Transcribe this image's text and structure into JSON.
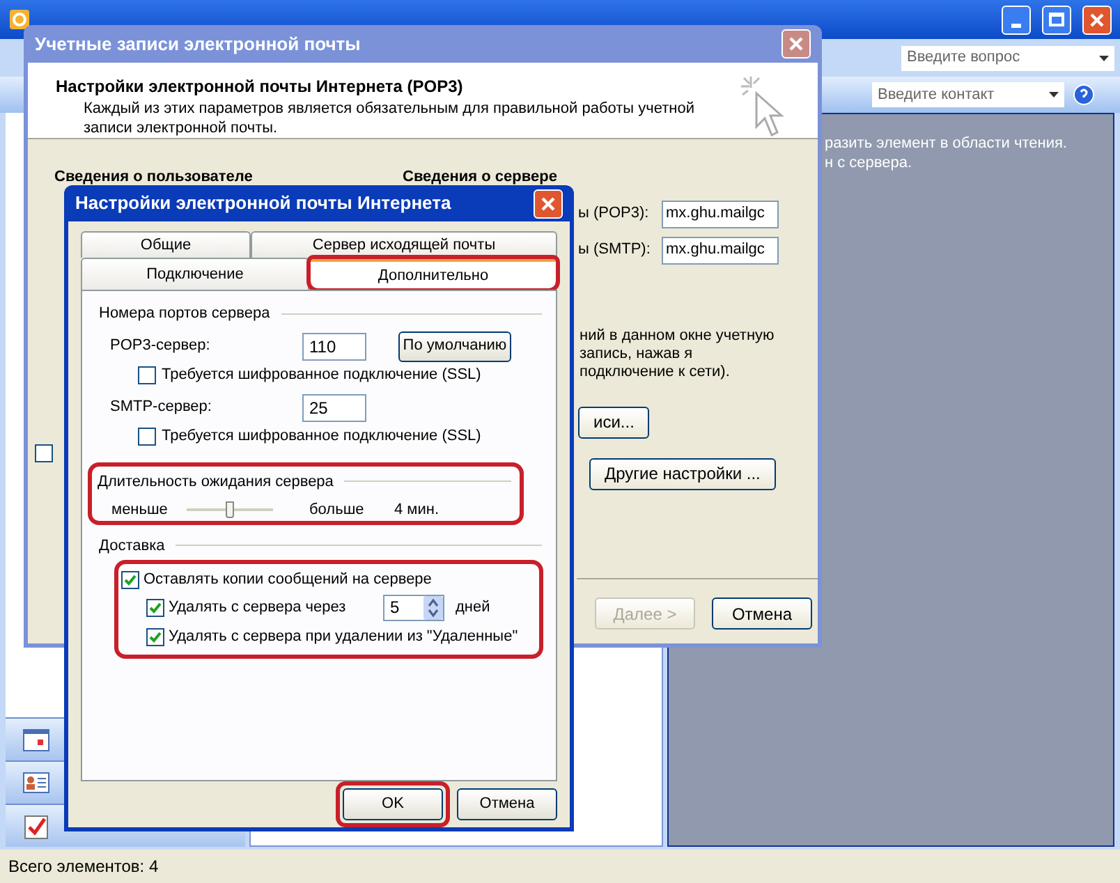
{
  "outlook": {
    "search_placeholder": "Введите вопрос",
    "contact_placeholder": "Введите контакт",
    "reading_pane_lines": [
      "разить элемент в области чтения.",
      "н с сервера."
    ],
    "nav_items": [
      {
        "kind": "calendar"
      },
      {
        "kind": "contacts"
      },
      {
        "kind": "tasks"
      }
    ],
    "status_bar": "Всего элементов: 4"
  },
  "accounts_wizard": {
    "title": "Учетные записи электронной почты",
    "heading": "Настройки электронной почты Интернета (POP3)",
    "description": "Каждый из этих параметров является обязательным для правильной работы учетной записи электронной почты.",
    "sections": [
      "Сведения о пользователе",
      "Сведения о сервере"
    ],
    "server_fields": [
      {
        "label": "ы (POP3):",
        "value": "mx.ghu.mailgc"
      },
      {
        "label": "ы (SMTP):",
        "value": "mx.ghu.mailgc"
      }
    ],
    "note": "ний в данном окне учетную запись, нажав я подключение к сети).",
    "test_button": "иси...",
    "more_button": "Другие настройки ...",
    "checkbox": {
      "checked": false
    },
    "buttons": [
      {
        "label": "Далее >",
        "disabled": true
      },
      {
        "label": "Отмена",
        "disabled": false
      }
    ]
  },
  "settings_dialog": {
    "title": "Настройки электронной почты Интернета",
    "tab_rows": [
      [
        {
          "label": "Общие",
          "selected": false,
          "highlighted": false
        },
        {
          "label": "Сервер исходящей почты",
          "selected": false,
          "highlighted": false
        }
      ],
      [
        {
          "label": "Подключение",
          "selected": false,
          "highlighted": false
        },
        {
          "label": "Дополнительно",
          "selected": true,
          "highlighted": true
        }
      ]
    ],
    "ports": {
      "title": "Номера портов сервера",
      "default_button": "По умолчанию",
      "servers": [
        {
          "label": "POP3-сервер:",
          "value": "110",
          "ssl_label": "Требуется шифрованное подключение (SSL)",
          "ssl_checked": false
        },
        {
          "label": "SMTP-сервер:",
          "value": "25",
          "ssl_label": "Требуется шифрованное подключение (SSL)",
          "ssl_checked": false
        }
      ]
    },
    "timeout": {
      "title": "Длительность ожидания сервера",
      "min_label": "меньше",
      "max_label": "больше",
      "level": 0.5,
      "reading": "4 мин.",
      "highlighted": true
    },
    "delivery": {
      "title": "Доставка",
      "highlighted": true,
      "leave_copies": {
        "label": "Оставлять копии сообщений на сервере",
        "checked": true
      },
      "delete_after": {
        "label": "Удалять с сервера через",
        "checked": true,
        "value": "5",
        "unit": "дней"
      },
      "delete_on_remove": {
        "label": "Удалять с сервера при удалении из \"Удаленные\"",
        "checked": true
      }
    },
    "buttons": [
      {
        "label": "OK",
        "highlighted": true
      },
      {
        "label": "Отмена",
        "highlighted": false
      }
    ]
  }
}
